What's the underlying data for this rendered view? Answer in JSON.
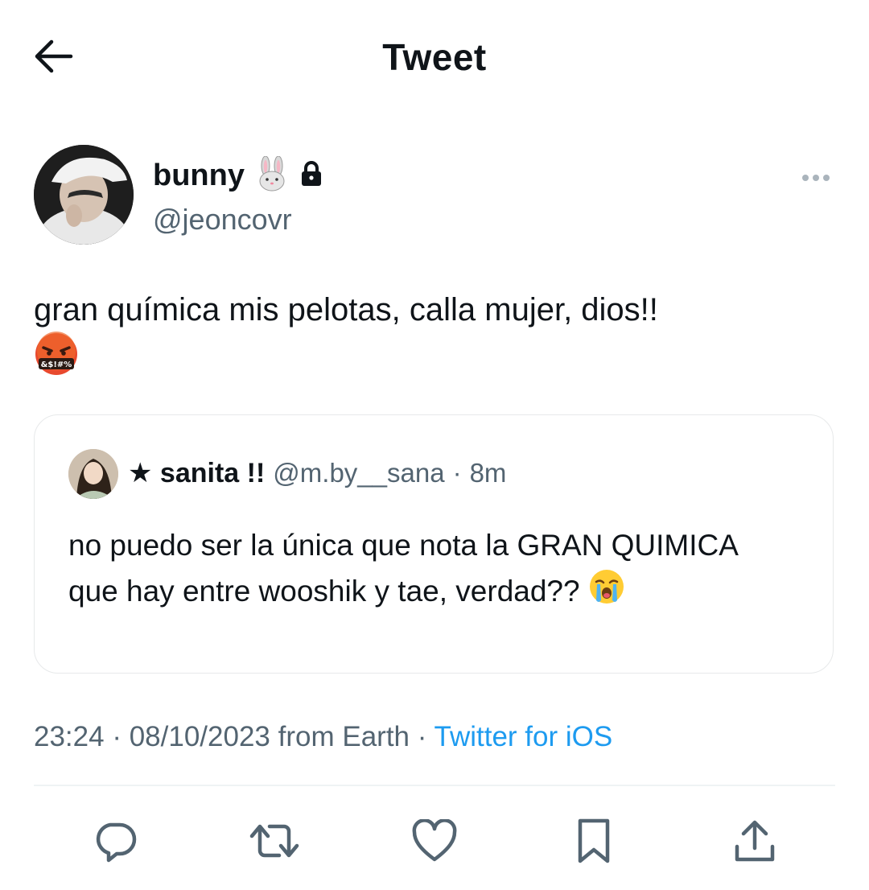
{
  "header": {
    "title": "Tweet",
    "back_icon": "arrow-left-icon"
  },
  "author": {
    "display_name": "bunny",
    "emoji": "🐰",
    "protected_icon": "lock-icon",
    "handle": "@jeoncovr"
  },
  "tweet": {
    "text": "gran química mis pelotas, calla mujer, dios!!",
    "emoji": "🤬"
  },
  "quote": {
    "display_name": "★ sanita !!",
    "handle": "@m.by__sana",
    "separator": "·",
    "time": "8m",
    "text": "no puedo ser la única que nota la GRAN QUIMICA que hay entre wooshik y tae, verdad??",
    "emoji": "😭"
  },
  "meta": {
    "time": "23:24",
    "separator": "·",
    "date": "08/10/2023",
    "location": "from Earth",
    "separator2": "·",
    "source": "Twitter for iOS"
  },
  "actions": {
    "reply_icon": "reply-icon",
    "retweet_icon": "retweet-icon",
    "like_icon": "heart-icon",
    "bookmark_icon": "bookmark-icon",
    "share_icon": "share-icon"
  },
  "colors": {
    "text": "#0f1419",
    "secondary": "#536471",
    "link": "#1d9bf0",
    "border": "#e7e9ea"
  }
}
